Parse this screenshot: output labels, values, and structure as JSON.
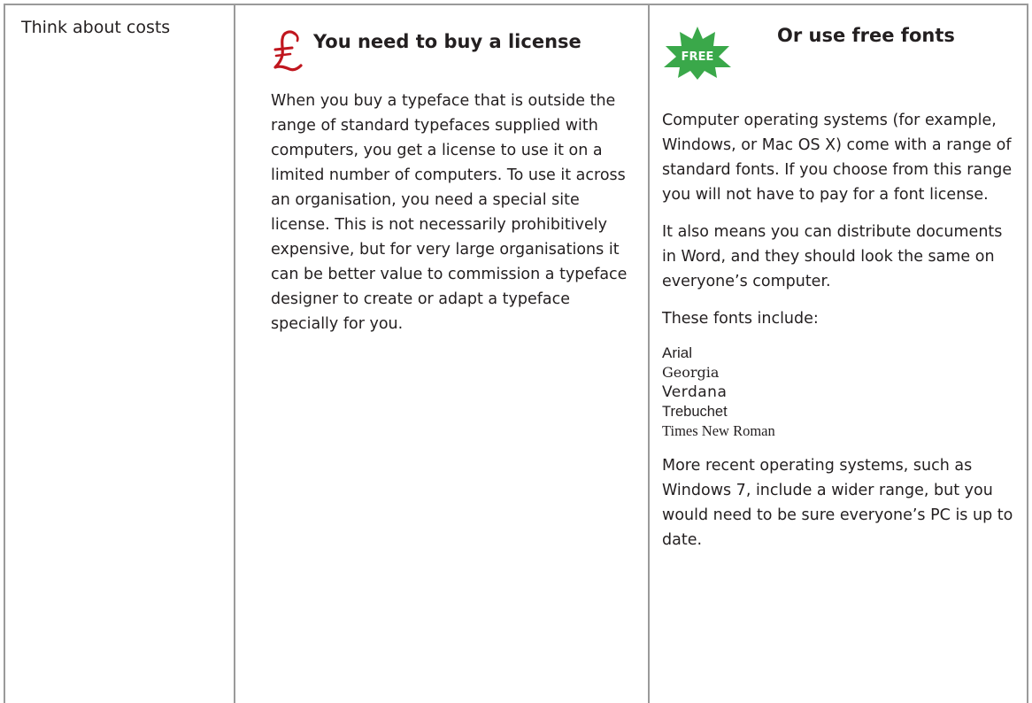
{
  "row": {
    "label": "Think about costs"
  },
  "license": {
    "heading": "You need to buy a license",
    "icon": "pound-sign-icon",
    "icon_color": "#c0161e",
    "text": "When you buy a typeface that is outside the range of standard typefaces supplied with computers, you get a license to use it on a limited number of computers. To use it across an organisation, you need a special site license. This is not necessarily prohibitively expensive, but for very large organisations it can be better value to commission a typeface designer to create or adapt a typeface specially for you."
  },
  "free": {
    "heading": "Or use free fonts",
    "badge_text": "FREE",
    "badge_color": "#3aa84a",
    "paragraphs": [
      "Computer operating systems (for example, Windows, or Mac OS X) come  with a range of standard fonts. If you choose from this range you will not have to pay for a font license.",
      "It also means you can distribute documents in Word, and they should look the same on everyone’s computer.",
      "These fonts include:"
    ],
    "fonts": [
      "Arial",
      "Georgia",
      "Verdana",
      "Trebuchet",
      "Times New Roman"
    ],
    "closing": "More recent operating systems, such as Windows 7, include a wider range, but you would need to be sure everyone’s PC is up to date."
  },
  "colors": {
    "rule": "#9a9a9a",
    "text": "#231f20"
  }
}
